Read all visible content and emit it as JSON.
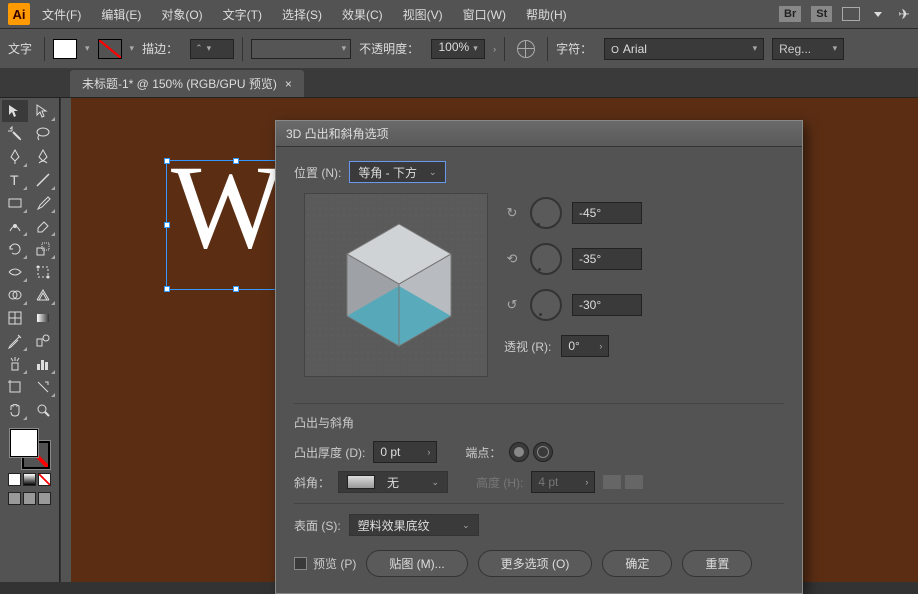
{
  "app": {
    "logo": "Ai"
  },
  "menu": {
    "file": "文件(F)",
    "edit": "编辑(E)",
    "object": "对象(O)",
    "type": "文字(T)",
    "select": "选择(S)",
    "effect": "效果(C)",
    "view": "视图(V)",
    "window": "窗口(W)",
    "help": "帮助(H)",
    "badge_br": "Br",
    "badge_st": "St"
  },
  "options": {
    "mode_label": "文字",
    "stroke_label": "描边：",
    "opacity_label": "不透明度：",
    "opacity_value": "100%",
    "char_label": "字符：",
    "font_name": "Arial",
    "font_style": "Reg..."
  },
  "tab": {
    "title": "未标题-1* @ 150% (RGB/GPU 预览)"
  },
  "canvas": {
    "text": "Wc"
  },
  "dialog": {
    "title": "3D 凸出和斜角选项",
    "position_label": "位置 (N):",
    "position_value": "等角 - 下方",
    "rot_x": "-45°",
    "rot_y": "-35°",
    "rot_z": "-30°",
    "perspective_label": "透视 (R):",
    "perspective_value": "0°",
    "extrude_section": "凸出与斜角",
    "depth_label": "凸出厚度 (D):",
    "depth_value": "0 pt",
    "cap_label": "端点：",
    "bevel_label": "斜角：",
    "bevel_value": "无",
    "height_label": "高度 (H):",
    "height_value": "4 pt",
    "surface_label": "表面 (S):",
    "surface_value": "塑料效果底纹",
    "preview_check": "预览 (P)",
    "btn_map": "贴图 (M)...",
    "btn_more": "更多选项 (O)",
    "btn_ok": "确定",
    "btn_reset": "重置"
  }
}
